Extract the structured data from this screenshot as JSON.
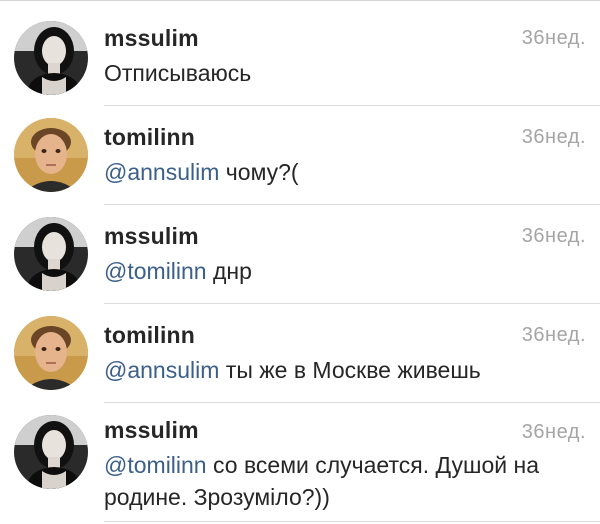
{
  "comments": [
    {
      "username": "mssulim",
      "time": "36нед.",
      "mention": "",
      "text": "Отписываюсь",
      "avatar": "woman-portrait-avatar"
    },
    {
      "username": "tomilinn",
      "time": "36нед.",
      "mention": "@annsulim",
      "text": " чому?(",
      "avatar": "man-portrait-avatar"
    },
    {
      "username": "mssulim",
      "time": "36нед.",
      "mention": "@tomilinn",
      "text": " днр",
      "avatar": "woman-portrait-avatar"
    },
    {
      "username": "tomilinn",
      "time": "36нед.",
      "mention": "@annsulim",
      "text": " ты же в Москве живешь",
      "avatar": "man-portrait-avatar"
    },
    {
      "username": "mssulim",
      "time": "36нед.",
      "mention": "@tomilinn",
      "text": " со всеми случается. Душой на родине. Зрозуміло?))",
      "avatar": "woman-portrait-avatar"
    }
  ],
  "colors": {
    "username": "#262626",
    "text": "#262626",
    "mention": "#3b5f89",
    "time": "#a5a5a5",
    "divider": "#dcdcdc"
  }
}
